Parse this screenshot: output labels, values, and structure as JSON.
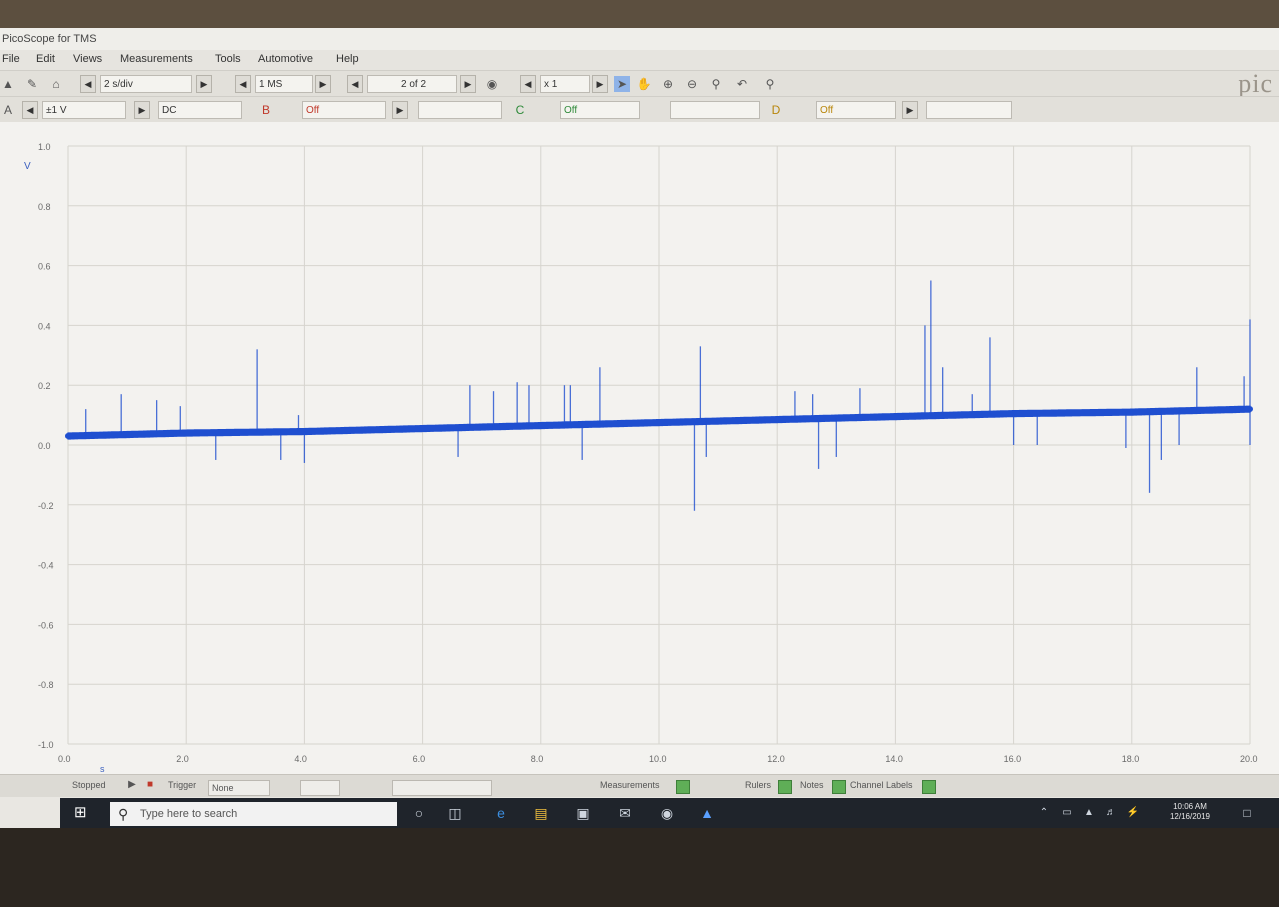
{
  "window": {
    "title": "PicoScope for TMS"
  },
  "menu": [
    "File",
    "Edit",
    "Views",
    "Measurements",
    "Tools",
    "Automotive",
    "Help"
  ],
  "toolbar1": {
    "timebase": "2 s/div",
    "samples": "1 MS",
    "buffer": "2 of 2",
    "zoom": "x 1",
    "logo": "pic"
  },
  "toolbar2": {
    "channel_a_range": "±1 V",
    "channel_a_coupling": "DC",
    "channel_b_state": "Off",
    "channel_c_state": "Off",
    "channel_d_state": "Off"
  },
  "chart_data": {
    "type": "line",
    "series": [
      {
        "color": "#1f4fd0",
        "baseline": [
          [
            0.0,
            0.03
          ],
          [
            2.0,
            0.04
          ],
          [
            4.0,
            0.045
          ],
          [
            6.0,
            0.055
          ],
          [
            8.0,
            0.065
          ],
          [
            10.0,
            0.075
          ],
          [
            12.0,
            0.085
          ],
          [
            14.0,
            0.095
          ],
          [
            16.0,
            0.105
          ],
          [
            18.0,
            0.11
          ],
          [
            20.0,
            0.12
          ]
        ],
        "spikes": [
          [
            0.3,
            0.12
          ],
          [
            0.9,
            0.17
          ],
          [
            1.5,
            0.15
          ],
          [
            1.9,
            0.13
          ],
          [
            3.2,
            0.32
          ],
          [
            3.9,
            0.1
          ],
          [
            6.8,
            0.2
          ],
          [
            7.2,
            0.18
          ],
          [
            7.6,
            0.21
          ],
          [
            7.8,
            0.2
          ],
          [
            8.4,
            0.2
          ],
          [
            8.5,
            0.2
          ],
          [
            9.0,
            0.26
          ],
          [
            10.7,
            0.33
          ],
          [
            12.3,
            0.18
          ],
          [
            12.6,
            0.17
          ],
          [
            13.4,
            0.19
          ],
          [
            14.5,
            0.4
          ],
          [
            14.6,
            0.55
          ],
          [
            14.8,
            0.26
          ],
          [
            15.6,
            0.36
          ],
          [
            15.3,
            0.17
          ],
          [
            19.1,
            0.26
          ],
          [
            19.9,
            0.23
          ],
          [
            20.0,
            0.42
          ],
          [
            2.5,
            -0.05
          ],
          [
            3.6,
            -0.05
          ],
          [
            4.0,
            -0.06
          ],
          [
            6.6,
            -0.04
          ],
          [
            8.7,
            -0.05
          ],
          [
            10.6,
            -0.22
          ],
          [
            10.8,
            -0.04
          ],
          [
            12.7,
            -0.08
          ],
          [
            13.0,
            -0.04
          ],
          [
            16.0,
            0.0
          ],
          [
            16.4,
            0.0
          ],
          [
            17.9,
            -0.01
          ],
          [
            18.3,
            -0.16
          ],
          [
            18.5,
            -0.05
          ],
          [
            18.8,
            0.0
          ],
          [
            20.0,
            0.0
          ]
        ]
      }
    ],
    "y_ticks": [
      "1.0",
      "0.8",
      "0.6",
      "0.4",
      "0.2",
      "0.0",
      "-0.2",
      "-0.4",
      "-0.6",
      "-0.8",
      "-1.0"
    ],
    "x_ticks": [
      "0.0",
      "2.0",
      "4.0",
      "6.0",
      "8.0",
      "10.0",
      "12.0",
      "14.0",
      "16.0",
      "18.0",
      "20.0"
    ],
    "yunit": "V",
    "xunit": "s",
    "ylim": [
      -1.0,
      1.0
    ],
    "xlim": [
      0.0,
      20.0
    ],
    "grid": true
  },
  "status": {
    "state": "Stopped",
    "trigger_label": "Trigger",
    "trigger_mode": "None",
    "measurements": "Measurements",
    "rulers": "Rulers",
    "notes": "Notes",
    "channel_labels": "Channel Labels"
  },
  "taskbar": {
    "search_placeholder": "Type here to search",
    "time": "10:06 AM",
    "date": "12/16/2019"
  },
  "colors": {
    "trace": "#1f4fd0",
    "plot_bg": "#f3f2ef",
    "taskbar": "#1f242b"
  }
}
